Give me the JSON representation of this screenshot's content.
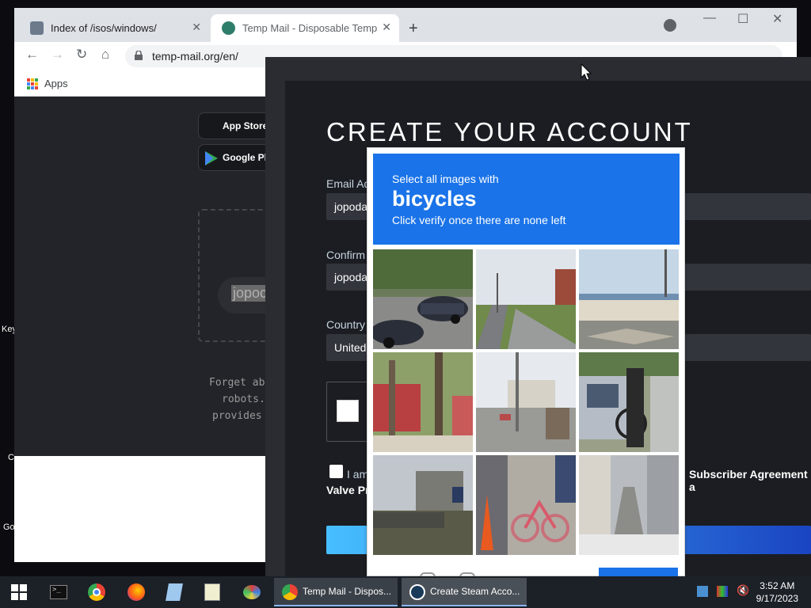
{
  "browser": {
    "tabs": [
      {
        "title": "Index of /isos/windows/",
        "active": false
      },
      {
        "title": "Temp Mail - Disposable Tempora",
        "active": true
      }
    ],
    "url": "temp-mail.org/en/",
    "bookmarks": {
      "apps_label": "Apps"
    }
  },
  "tempmail": {
    "app_store": "App Store",
    "google_play": "Google Pla",
    "email_fragment": "jopoc",
    "desc_lines": [
      "Forget ab",
      "robots.",
      "provides"
    ]
  },
  "desktop_labels": [
    "Key",
    "C",
    "Go"
  ],
  "steam": {
    "title": "CREATE YOUR ACCOUNT",
    "email_label": "Email Ad",
    "email_value": "jopoda",
    "confirm_label": "Confirm",
    "confirm_value": "jopoda",
    "country_label": "Country",
    "country_value": "United",
    "agree_text_1": "I am",
    "agree_text_2": "Subscriber Agreement a",
    "agree_text_3": "Valve Pr"
  },
  "captcha": {
    "line1": "Select all images with",
    "target": "bicycles",
    "line3": "Click verify once there are none left",
    "tiles": [
      "cars-parked",
      "road-sidewalk",
      "beach-crosswalk",
      "tree-bushes",
      "street-poles",
      "car-bicycle",
      "old-shed",
      "red-bicycle-cone",
      "narrow-street"
    ]
  },
  "taskbar": {
    "windows": [
      {
        "label": "Temp Mail - Dispos..."
      },
      {
        "label": "Create Steam Acco..."
      }
    ],
    "time": "3:52 AM",
    "date": "9/17/2023"
  },
  "colors": {
    "accent": "#1a73e8",
    "steam_bg": "#1b1d22",
    "taskbar": "#1c2027"
  }
}
